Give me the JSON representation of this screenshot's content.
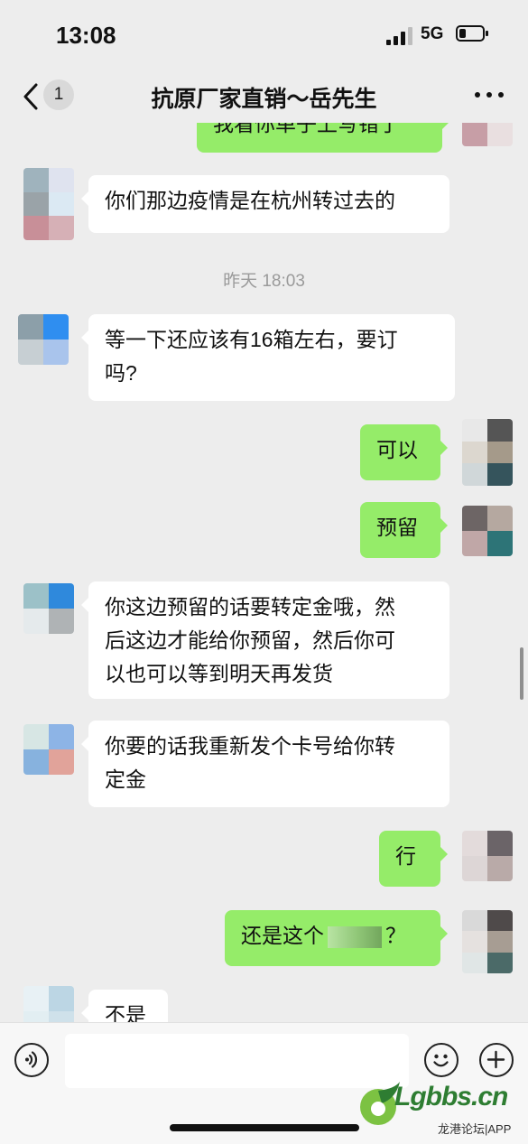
{
  "status_bar": {
    "time": "13:08",
    "network": "5G"
  },
  "nav": {
    "badge_count": "1",
    "title": "抗原厂家直销～岳先生"
  },
  "messages": {
    "m0": "我看你单子上写错了",
    "m1": "你们那边疫情是在杭州转过去的",
    "timestamp": "昨天 18:03",
    "m2_line1": "等一下还应该有16箱左右，要订",
    "m2_line2": "吗?",
    "m3": "可以",
    "m4": "预留",
    "m5_line1": "你这边预留的话要转定金哦，然",
    "m5_line2": "后这边才能给你预留，然后你可",
    "m5_line3": "以也可以等到明天再发货",
    "m6_line1": "你要的话我重新发个卡号给你转",
    "m6_line2": "定金",
    "m7": "行",
    "m8_prefix": "还是这个",
    "m8_suffix": "？",
    "m9": "不是"
  },
  "input": {
    "placeholder": ""
  },
  "watermark": {
    "brand": "Lgbbs.cn",
    "sub": "龙港论坛|APP"
  },
  "colors": {
    "background": "#ededed",
    "sent_bubble": "#95ec69",
    "received_bubble": "#ffffff"
  }
}
